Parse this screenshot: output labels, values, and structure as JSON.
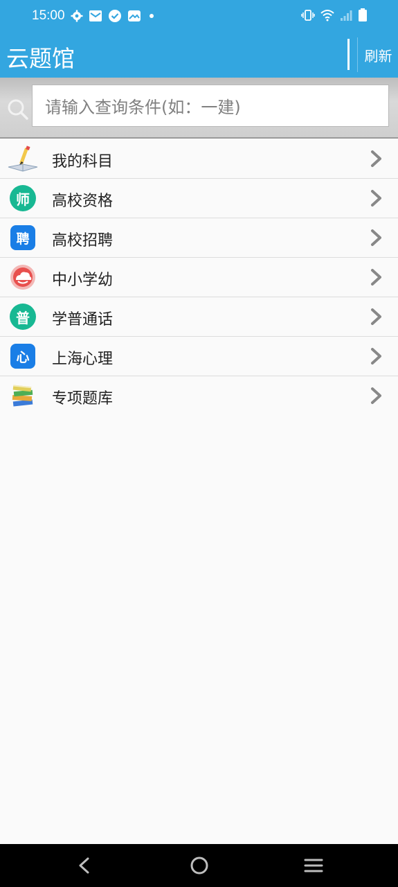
{
  "status_bar": {
    "time": "15:00",
    "left_icons": [
      "gear-icon",
      "mail-icon",
      "check-circle-icon",
      "photo-icon",
      "dot-icon"
    ],
    "right_icons": [
      "vibrate-icon",
      "wifi-icon",
      "signal-icon",
      "battery-icon"
    ]
  },
  "app_bar": {
    "title": "云题馆",
    "refresh_label": "刷新"
  },
  "search": {
    "placeholder": "请输入查询条件(如：一建)"
  },
  "list": {
    "items": [
      {
        "label": "我的科目",
        "icon": "pencil-book-icon"
      },
      {
        "label": "高校资格",
        "icon": "teacher-icon",
        "glyph": "师",
        "color": "#18b893"
      },
      {
        "label": "高校招聘",
        "icon": "recruit-icon",
        "glyph": "聘",
        "color": "#1a7ee6"
      },
      {
        "label": "中小学幼",
        "icon": "cloud-icon",
        "color": "#e8504e"
      },
      {
        "label": "学普通话",
        "icon": "mandarin-icon",
        "glyph": "普",
        "color": "#18b893"
      },
      {
        "label": "上海心理",
        "icon": "psychology-icon",
        "glyph": "心",
        "color": "#1a7ee6"
      },
      {
        "label": "专项题库",
        "icon": "books-icon"
      }
    ]
  },
  "nav_bar": {
    "buttons": [
      "back-icon",
      "home-icon",
      "menu-icon"
    ]
  }
}
